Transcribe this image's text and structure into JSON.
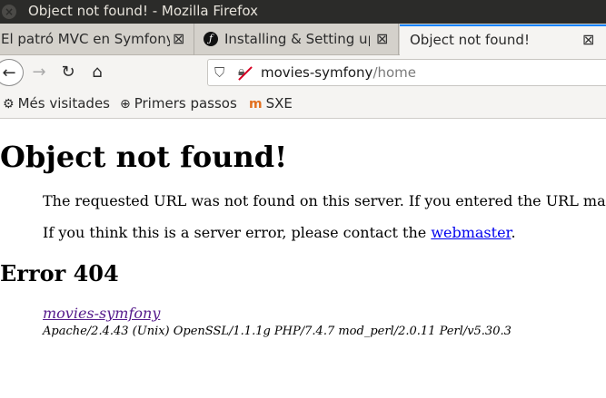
{
  "window": {
    "title": "Object not found! - Mozilla Firefox",
    "close_glyph": "×"
  },
  "tabs": [
    {
      "label": "El patró MVC en Symfony",
      "close": "⊠"
    },
    {
      "label": "Installing & Setting up",
      "favicon": "sf",
      "close": "⊠"
    },
    {
      "label": "Object not found!",
      "close": "⊠",
      "active": true
    }
  ],
  "toolbar": {
    "back_glyph": "←",
    "forward_glyph": "→",
    "reload_glyph": "↻",
    "home_glyph": "⌂",
    "url_host": "movies-symfony",
    "url_path": "/home",
    "shield_icon": "shield-icon",
    "insecure_icon": "insecure-lock-icon"
  },
  "bookmarks": [
    {
      "label": "Més visitades",
      "icon": "⚙"
    },
    {
      "label": "Primers passos",
      "icon": "⊕"
    },
    {
      "label": "SXE",
      "icon": "m"
    }
  ],
  "page": {
    "heading": "Object not found!",
    "line1": "The requested URL was not found on this server. If you entered the URL manually please check your spelling and try again.",
    "line2_before": "If you think this is a server error, please contact the ",
    "line2_link": "webmaster",
    "line2_after": ".",
    "error_heading": "Error 404",
    "server_link": "movies-symfony",
    "server_signature": "Apache/2.4.43 (Unix) OpenSSL/1.1.1g PHP/7.4.7 mod_perl/2.0.11 Perl/v5.30.3"
  },
  "colors": {
    "titlebar_bg": "#2b2b29",
    "active_tab_accent": "#0a84ff",
    "link": "#0000ee",
    "visited_link": "#551a8b"
  }
}
